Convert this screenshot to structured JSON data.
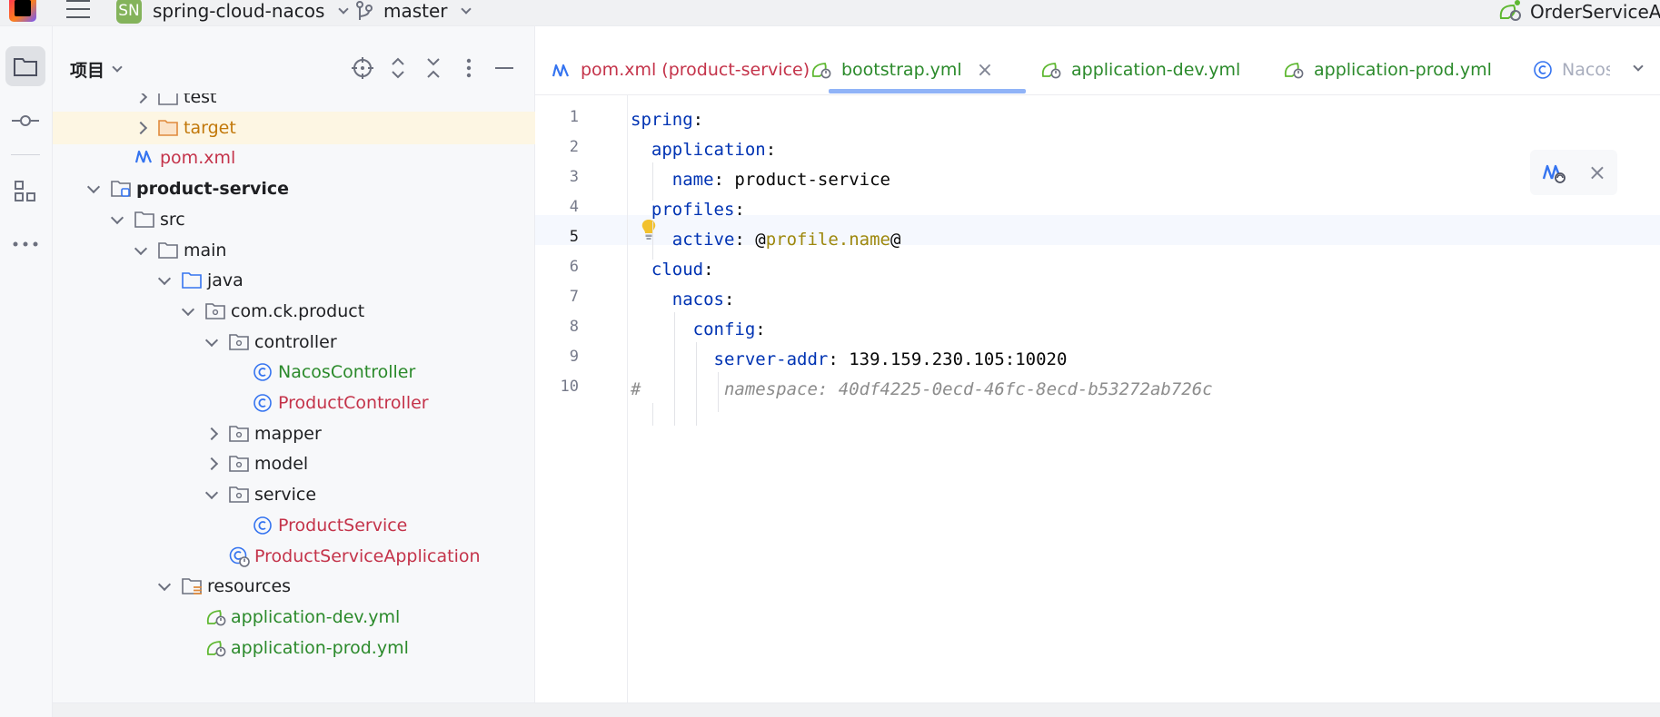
{
  "titlebar": {
    "project_badge": "SN",
    "project_name": "spring-cloud-nacos",
    "branch": "master",
    "run_config": "OrderServiceApp"
  },
  "panel": {
    "title": "项目"
  },
  "tree": [
    {
      "label": "test",
      "icon": "folder-icon",
      "arrow": "right",
      "color": "#1e1f22",
      "bold": false
    },
    {
      "label": "target",
      "icon": "folder-orange-icon",
      "arrow": "right",
      "color": "#c2780a",
      "bold": false,
      "selected": true
    },
    {
      "label": "pom.xml",
      "icon": "maven-icon",
      "arrow": "",
      "color": "#c4334a",
      "bold": false
    },
    {
      "label": "product-service",
      "icon": "module-icon",
      "arrow": "down",
      "color": "#1e1f22",
      "bold": true
    },
    {
      "label": "src",
      "icon": "folder-icon",
      "arrow": "down",
      "color": "#1e1f22",
      "bold": false
    },
    {
      "label": "main",
      "icon": "folder-icon",
      "arrow": "down",
      "color": "#1e1f22",
      "bold": false
    },
    {
      "label": "java",
      "icon": "folder-blue-icon",
      "arrow": "down",
      "color": "#1e1f22",
      "bold": false
    },
    {
      "label": "com.ck.product",
      "icon": "package-icon",
      "arrow": "down",
      "color": "#1e1f22",
      "bold": false
    },
    {
      "label": "controller",
      "icon": "package-icon",
      "arrow": "down",
      "color": "#1e1f22",
      "bold": false
    },
    {
      "label": "NacosController",
      "icon": "class-icon",
      "arrow": "",
      "color": "#2b8a2b",
      "bold": false
    },
    {
      "label": "ProductController",
      "icon": "class-icon",
      "arrow": "",
      "color": "#c4334a",
      "bold": false
    },
    {
      "label": "mapper",
      "icon": "package-icon",
      "arrow": "right",
      "color": "#1e1f22",
      "bold": false
    },
    {
      "label": "model",
      "icon": "package-icon",
      "arrow": "right",
      "color": "#1e1f22",
      "bold": false
    },
    {
      "label": "service",
      "icon": "package-icon",
      "arrow": "down",
      "color": "#1e1f22",
      "bold": false
    },
    {
      "label": "ProductService",
      "icon": "class-icon",
      "arrow": "",
      "color": "#c4334a",
      "bold": false
    },
    {
      "label": "ProductServiceApplication",
      "icon": "spring-boot-class-icon",
      "arrow": "",
      "color": "#c4334a",
      "bold": false
    },
    {
      "label": "resources",
      "icon": "resources-folder-icon",
      "arrow": "down",
      "color": "#1e1f22",
      "bold": false
    },
    {
      "label": "application-dev.yml",
      "icon": "spring-yaml-icon",
      "arrow": "",
      "color": "#2b8a2b",
      "bold": false
    },
    {
      "label": "application-prod.yml",
      "icon": "spring-yaml-icon",
      "arrow": "",
      "color": "#2b8a2b",
      "bold": false
    }
  ],
  "tabs": [
    {
      "label": "pom.xml (product-service)",
      "icon": "maven-icon",
      "color": "#c4334a"
    },
    {
      "label": "bootstrap.yml",
      "icon": "spring-yaml-icon",
      "color": "#2b8a2b",
      "active": true,
      "close": "×"
    },
    {
      "label": "application-dev.yml",
      "icon": "spring-yaml-icon",
      "color": "#2b8a2b"
    },
    {
      "label": "application-prod.yml",
      "icon": "spring-yaml-icon",
      "color": "#2b8a2b"
    },
    {
      "label": "Nacos",
      "icon": "class-icon",
      "color": "#a8adbd"
    }
  ],
  "code": [
    {
      "no": "1",
      "parts": [
        {
          "t": "spring",
          "c": "k"
        },
        {
          "t": ":",
          "c": "v"
        }
      ]
    },
    {
      "no": "2",
      "parts": [
        {
          "t": "  application",
          "c": "k"
        },
        {
          "t": ":",
          "c": "v"
        }
      ]
    },
    {
      "no": "3",
      "parts": [
        {
          "t": "    name",
          "c": "k"
        },
        {
          "t": ": product-service",
          "c": "v"
        }
      ]
    },
    {
      "no": "4",
      "parts": [
        {
          "t": "  profiles",
          "c": "k"
        },
        {
          "t": ":",
          "c": "v"
        }
      ]
    },
    {
      "no": "5",
      "parts": [
        {
          "t": "    active",
          "c": "k"
        },
        {
          "t": ": @",
          "c": "v"
        },
        {
          "t": "profile.name",
          "c": "p"
        },
        {
          "t": "@",
          "c": "v"
        }
      ]
    },
    {
      "no": "6",
      "parts": [
        {
          "t": "  cloud",
          "c": "k"
        },
        {
          "t": ":",
          "c": "v"
        }
      ]
    },
    {
      "no": "7",
      "parts": [
        {
          "t": "    nacos",
          "c": "k"
        },
        {
          "t": ":",
          "c": "v"
        }
      ]
    },
    {
      "no": "8",
      "parts": [
        {
          "t": "      config",
          "c": "k"
        },
        {
          "t": ":",
          "c": "v"
        }
      ]
    },
    {
      "no": "9",
      "parts": [
        {
          "t": "        server-addr",
          "c": "k"
        },
        {
          "t": ": 139.159.230.105:10020",
          "c": "v"
        }
      ]
    },
    {
      "no": "10",
      "parts": [
        {
          "t": "#",
          "c": "c"
        },
        {
          "t": "        namespace: 40df4225-0ecd-46fc-8ecd-b53272ab726c",
          "c": "c"
        }
      ]
    }
  ],
  "floating_toolbar": {
    "close": "×"
  }
}
